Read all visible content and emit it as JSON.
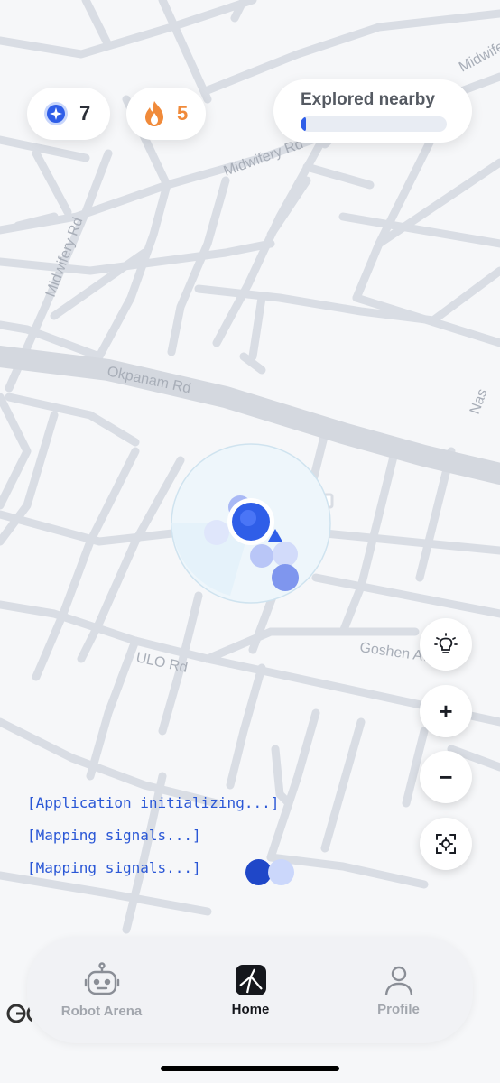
{
  "stats": {
    "gems": "7",
    "streak": "5"
  },
  "explored": {
    "label": "Explored nearby",
    "progress_pct": 2
  },
  "map": {
    "roads": [
      "Okpanam Rd",
      "Midwifery Rd",
      "Midwifery Rd",
      "ULO Rd",
      "Goshen Ave",
      "Midwifery",
      "Nas"
    ]
  },
  "log": [
    "[Application initializing...]",
    "[Mapping signals...]",
    "[Mapping signals...]"
  ],
  "controls": {
    "zoom_in": "+",
    "zoom_out": "−"
  },
  "nav": {
    "robot_arena": "Robot Arena",
    "home": "Home",
    "profile": "Profile"
  },
  "colors": {
    "accent": "#2f5ee8",
    "streak": "#f08a3a",
    "road": "#d9dde4",
    "log_text": "#2a57d6"
  }
}
